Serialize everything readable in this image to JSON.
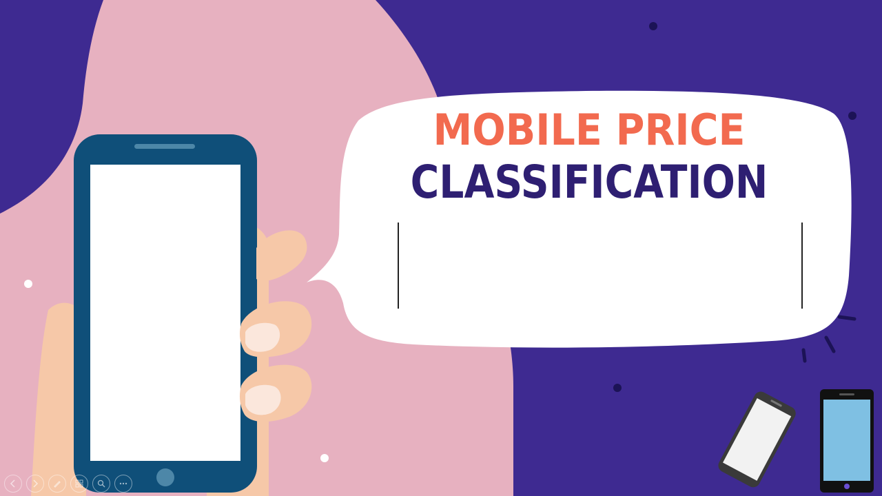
{
  "slide": {
    "title_line1": "MOBILE PRICE",
    "title_line2": "CLASSIFICATION"
  },
  "colors": {
    "background": "#3e2a91",
    "pink_shape": "#e7b1c0",
    "title_accent": "#f26a4f",
    "title_dark": "#2e1f72",
    "phone_frame": "#0f4f79",
    "hand_skin": "#f6c8a8",
    "small_phone_screen": "#7fc0e3"
  },
  "toolbar": {
    "buttons": [
      {
        "name": "previous-slide-button",
        "icon": "arrow-left-icon"
      },
      {
        "name": "next-slide-button",
        "icon": "arrow-right-icon"
      },
      {
        "name": "pen-tool-button",
        "icon": "pen-icon"
      },
      {
        "name": "see-all-slides-button",
        "icon": "grid-icon"
      },
      {
        "name": "zoom-button",
        "icon": "magnifier-icon"
      },
      {
        "name": "more-options-button",
        "icon": "more-icon"
      }
    ]
  }
}
